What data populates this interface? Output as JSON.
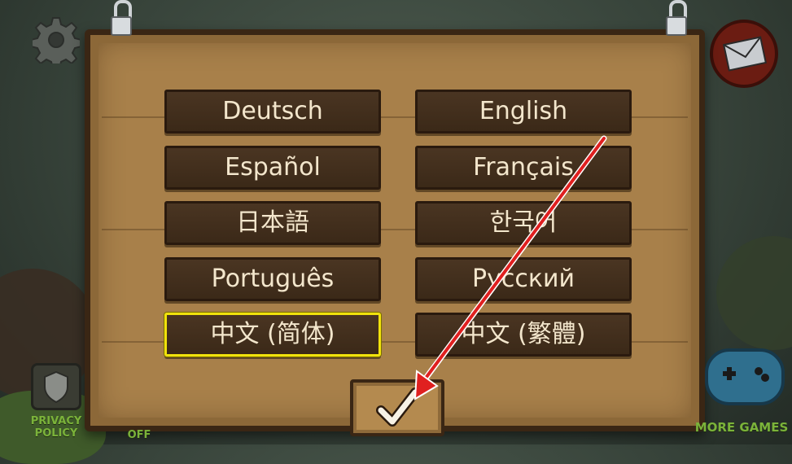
{
  "languages": [
    {
      "label": "Deutsch",
      "selected": false
    },
    {
      "label": "English",
      "selected": false
    },
    {
      "label": "Español",
      "selected": false
    },
    {
      "label": "Français",
      "selected": false
    },
    {
      "label": "日本語",
      "selected": false
    },
    {
      "label": "한국어",
      "selected": false
    },
    {
      "label": "Português",
      "selected": false
    },
    {
      "label": "Русский",
      "selected": false
    },
    {
      "label": "中文 (简体)",
      "selected": true
    },
    {
      "label": "中文 (繁體)",
      "selected": false
    }
  ],
  "bottom_left": {
    "privacy_label": "PRIVACY\nPOLICY",
    "off_label": "OFF"
  },
  "bottom_right": {
    "more_games_label": "MORE GAMES"
  },
  "colors": {
    "highlight": "#f1e20c",
    "arrow": "#e02020"
  },
  "icons": {
    "settings": "gear-icon",
    "mail": "mail-icon",
    "confirm": "checkmark-icon",
    "privacy": "shield-icon",
    "games": "gamepad-icon"
  }
}
